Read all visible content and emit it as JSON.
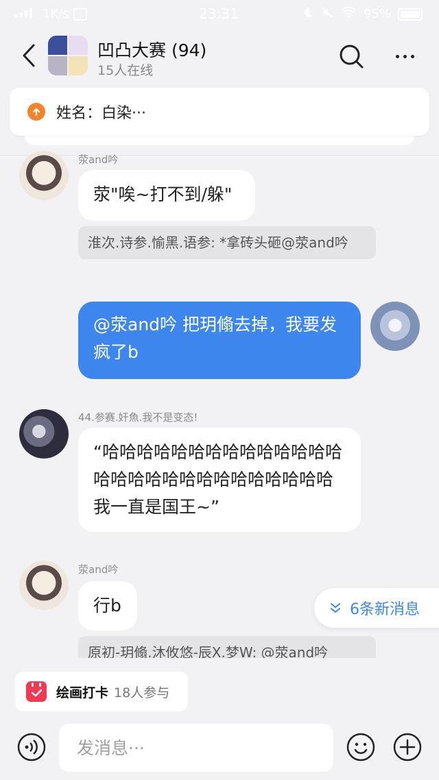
{
  "status_bar": {
    "speed": "1K/s",
    "time": "23:31",
    "battery": "95%"
  },
  "header": {
    "title": "凹凸大赛 (94)",
    "subtitle": "15人在线",
    "group_avatar_colors": [
      "#3c4f9c",
      "#e8dcf0",
      "#b9b3c6",
      "#f3e3b6"
    ]
  },
  "notice": {
    "text": "姓名：白染···",
    "icon": "upload-arrow-icon",
    "icon_color": "#f6822b"
  },
  "messages": [
    {
      "sender": "荥and吟",
      "text": "荥\"唉~打不到/躲\"",
      "reply": "淮次.诗参.愉黑.语参: *拿砖头砸@荥and吟"
    },
    {
      "sender": "",
      "self": true,
      "text": "@荥and吟  把玥翛去掉，我要发疯了b"
    },
    {
      "sender": "44.参赛.奸魚.我不是变态!",
      "text": "“哈哈哈哈哈哈哈哈哈哈哈哈哈哈哈哈哈哈哈哈哈哈哈哈哈哈哈哈我一直是国王~”"
    },
    {
      "sender": "荥and吟",
      "text": "行b",
      "reply": "原初-玥翛.沐攸悠-辰X.梦W: @荥and吟"
    }
  ],
  "new_messages": {
    "label": "6条新消息"
  },
  "activity": {
    "name": "绘画打卡",
    "count": "18人参与",
    "icon_color": "#ee3a52"
  },
  "composer": {
    "placeholder": "发消息···"
  },
  "colors": {
    "accent": "#3d86ee",
    "background": "#f2f2f4"
  }
}
